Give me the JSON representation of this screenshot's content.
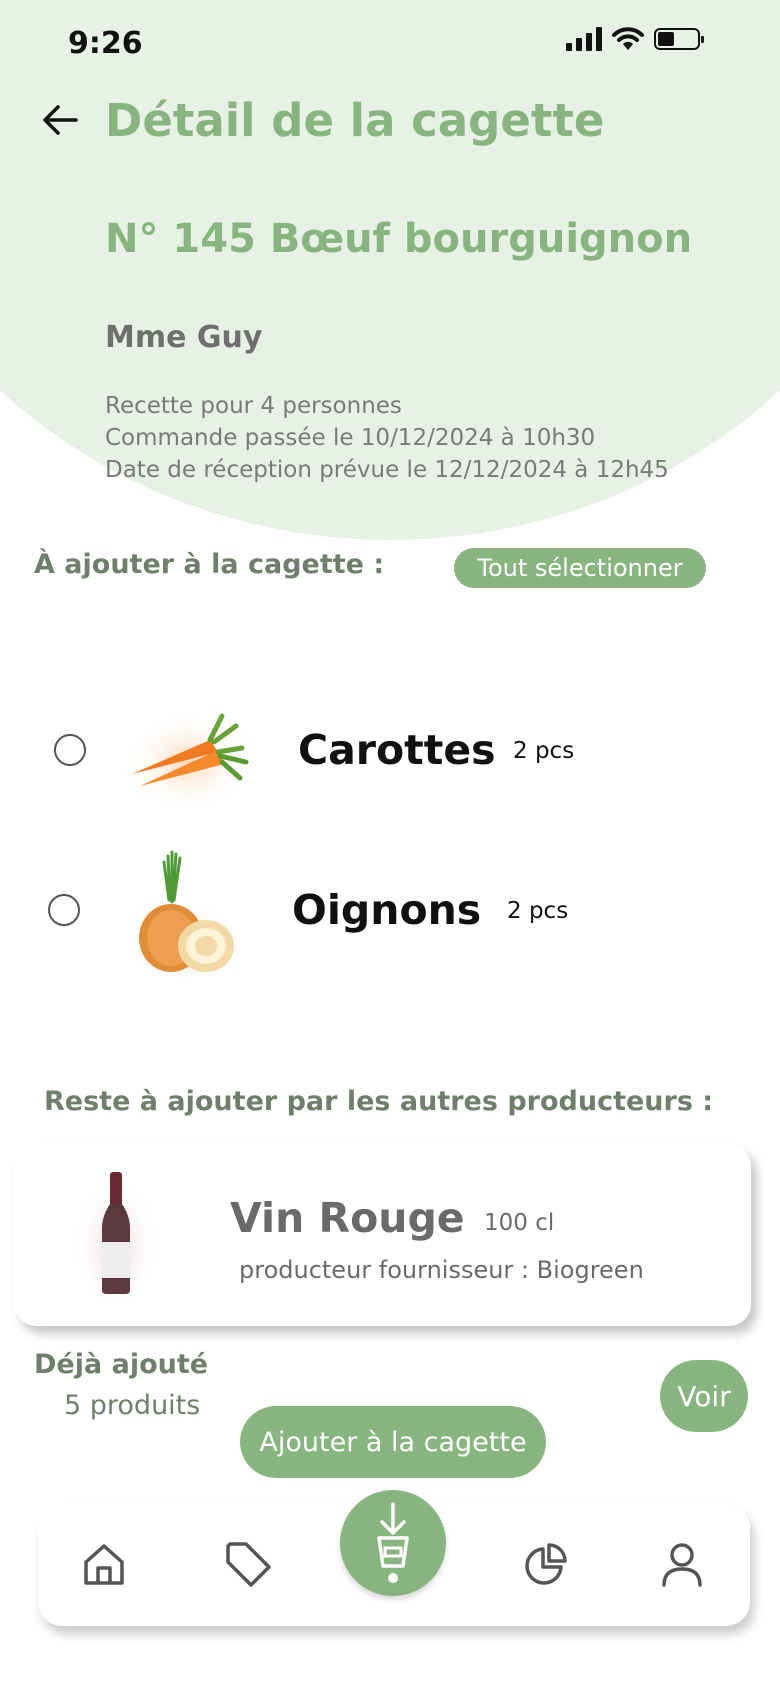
{
  "status_bar": {
    "time": "9:26"
  },
  "header": {
    "title": "Détail de la cagette",
    "recipe": "N° 145 Bœuf bourguignon",
    "client": "Mme Guy",
    "info": [
      "Recette pour 4 personnes",
      "Commande passée le 10/12/2024 à 10h30",
      "Date de réception prévue le 12/12/2024 à 12h45"
    ]
  },
  "to_add": {
    "title": "À ajouter à la cagette :",
    "select_all_label": "Tout sélectionner",
    "items": [
      {
        "name": "Carottes",
        "qty": "2 pcs",
        "icon": "carrot-image",
        "checked": false
      },
      {
        "name": "Oignons",
        "qty": "2 pcs",
        "icon": "onion-image",
        "checked": false
      }
    ]
  },
  "others": {
    "title": "Reste à ajouter par les autres producteurs :",
    "item": {
      "name": "Vin Rouge",
      "qty": "100 cl",
      "supplier": "producteur fournisseur : Biogreen",
      "icon": "wine-bottle-image"
    }
  },
  "already_added": {
    "label": "Déjà ajouté",
    "count": "5 produits",
    "view_label": "Voir"
  },
  "add_button_label": "Ajouter à la cagette",
  "bottom_nav": {
    "items": [
      "home-icon",
      "tag-icon",
      "crate-download-icon",
      "pie-chart-icon",
      "user-icon"
    ],
    "active": "crate-download-icon"
  },
  "colors": {
    "accent": "#88b57f",
    "hero_background": "#e8f1e6",
    "section_text": "#6f7f6c",
    "muted_text": "#7a7a7a"
  }
}
